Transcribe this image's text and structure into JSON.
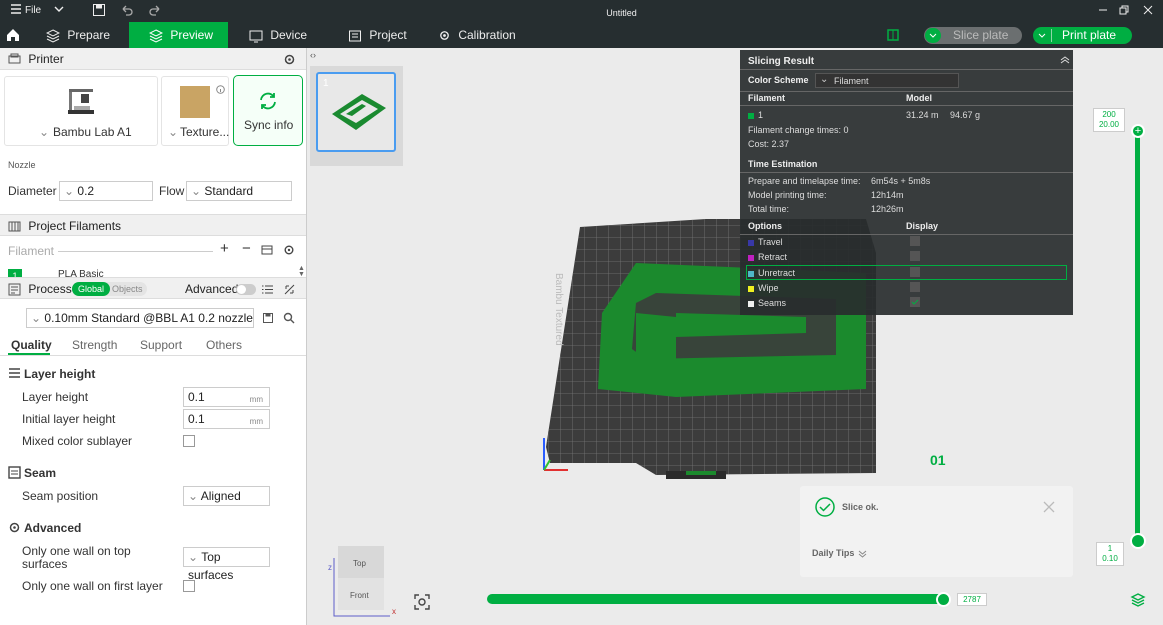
{
  "titlebar": {
    "file": "File",
    "title": "Untitled"
  },
  "tabs": {
    "prepare": "Prepare",
    "preview": "Preview",
    "device": "Device",
    "project": "Project",
    "calibration": "Calibration"
  },
  "buttons": {
    "slice_plate": "Slice plate",
    "print_plate": "Print plate"
  },
  "printer": {
    "section": "Printer",
    "name": "Bambu Lab A1",
    "plate": "Texture...",
    "sync": "Sync info",
    "nozzle": "Nozzle",
    "diameter_label": "Diameter",
    "diameter": "0.2",
    "flow_label": "Flow",
    "flow": "Standard"
  },
  "filaments": {
    "section": "Project Filaments",
    "placeholder": "Filament",
    "item_index": "1",
    "item_name": "PLA Basic"
  },
  "process": {
    "section": "Process",
    "global": "Global",
    "objects": "Objects",
    "advanced": "Advanced",
    "preset": "0.10mm Standard @BBL A1 0.2 nozzle",
    "tabs": [
      "Quality",
      "Strength",
      "Support",
      "Others"
    ],
    "layer_height_section": "Layer height",
    "layer_height_label": "Layer height",
    "layer_height": "0.1",
    "initial_layer_label": "Initial layer height",
    "initial_layer": "0.1",
    "unit": "mm",
    "mixed_color": "Mixed color sublayer",
    "seam_section": "Seam",
    "seam_position_label": "Seam position",
    "seam_position": "Aligned",
    "advanced_section": "Advanced",
    "one_wall_top_label_1": "Only one wall on top",
    "one_wall_top_label_2": "surfaces",
    "one_wall_top": "Top surfaces",
    "one_wall_first": "Only one wall on first layer"
  },
  "plate": {
    "number": "1",
    "bed_label": "01",
    "bed_text": "Bambu Textured"
  },
  "slicing": {
    "title": "Slicing Result",
    "color_scheme_label": "Color Scheme",
    "color_scheme": "Filament",
    "filament_hdr": "Filament",
    "model_hdr": "Model",
    "filament_idx": "1",
    "length": "31.24 m",
    "weight": "94.67 g",
    "change_times": "Filament change times:  0",
    "cost": "Cost:  2.37",
    "time_hdr": "Time Estimation",
    "prepare_label": "Prepare and timelapse time:",
    "prepare_val": "6m54s + 5m8s",
    "model_time_label": "Model printing time:",
    "model_time": "12h14m",
    "total_label": "Total time:",
    "total_time": "12h26m",
    "options_hdr": "Options",
    "display_hdr": "Display",
    "options": [
      "Travel",
      "Retract",
      "Unretract",
      "Wipe",
      "Seams"
    ],
    "colors": {
      "filament": "#00ae42",
      "travel": "#3838a8",
      "retract": "#c020c0",
      "unretract": "#50b8c8",
      "wipe": "#f0f020",
      "seams": "#f0f0f0"
    }
  },
  "notification": {
    "status": "Slice ok.",
    "tips": "Daily Tips"
  },
  "layer_slider": {
    "top_layer": "200",
    "top_height": "20.00",
    "bottom_layer": "1",
    "bottom_height": "0.10"
  },
  "move_slider": {
    "value": "2787"
  },
  "cube": {
    "top": "Top",
    "front": "Front",
    "z": "z",
    "x": "x"
  }
}
